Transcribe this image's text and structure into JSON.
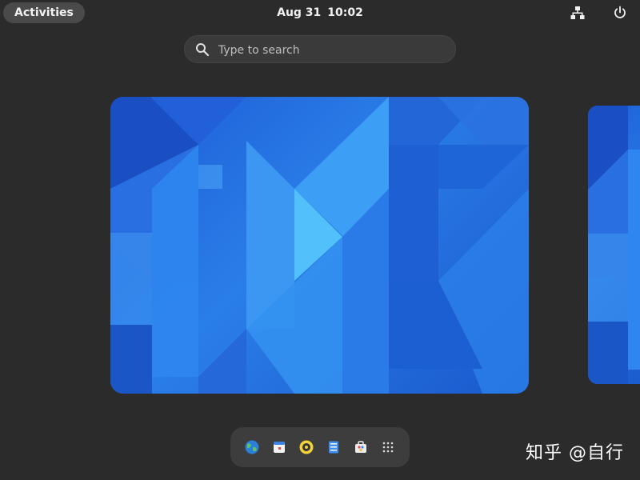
{
  "topbar": {
    "activities_label": "Activities",
    "clock": {
      "date": "Aug 31",
      "time": "10:02"
    },
    "tray": {
      "network_icon": "network-wired-icon",
      "power_icon": "power-icon"
    }
  },
  "search": {
    "placeholder": "Type to search",
    "value": "",
    "icon": "search-icon"
  },
  "workspaces": [
    {
      "name": "workspace-1",
      "active": true
    },
    {
      "name": "workspace-2",
      "active": false
    }
  ],
  "dash": {
    "items": [
      {
        "name": "web-browser",
        "icon": "globe-icon"
      },
      {
        "name": "calendar",
        "icon": "calendar-icon"
      },
      {
        "name": "music-player",
        "icon": "disc-icon"
      },
      {
        "name": "files",
        "icon": "files-icon"
      },
      {
        "name": "software",
        "icon": "software-center-icon"
      },
      {
        "name": "show-apps",
        "icon": "app-grid-icon"
      }
    ]
  },
  "watermark": "知乎 @自行",
  "colors": {
    "background": "#2b2b2b",
    "wallpaper_blue": "#1c5cd6",
    "panel": "#3d3d3d"
  }
}
